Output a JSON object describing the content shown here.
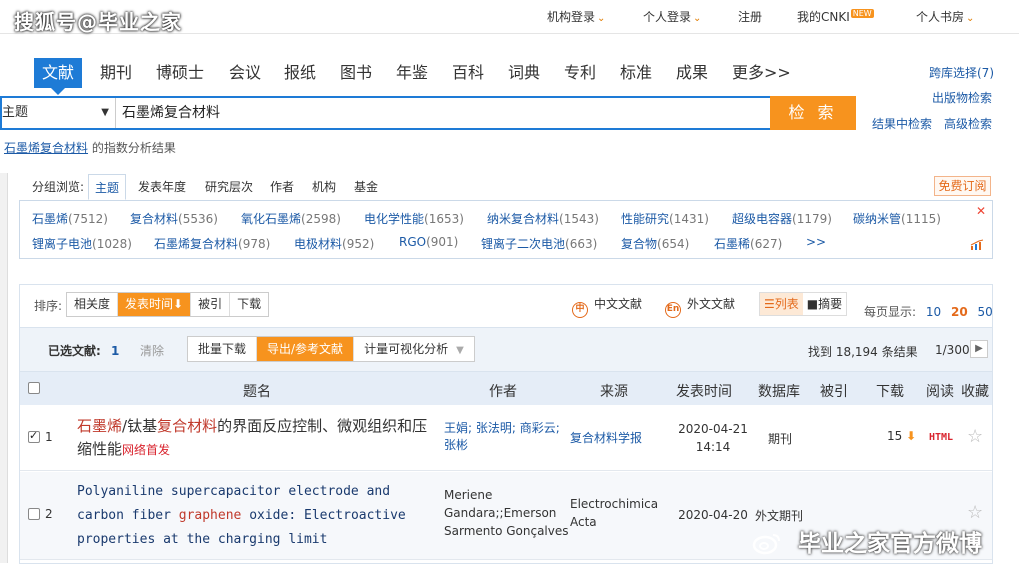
{
  "watermark_top": "搜狐号@毕业之家",
  "watermark_bottom": "毕业之家官方微博",
  "topbar": {
    "org_login": "机构登录",
    "personal_login": "个人登录",
    "register": "注册",
    "my_cnki": "我的CNKI",
    "new_badge": "NEW",
    "bookroom": "个人书房"
  },
  "nav": {
    "tabs": [
      "文献",
      "期刊",
      "博硕士",
      "会议",
      "报纸",
      "图书",
      "年鉴",
      "百科",
      "词典",
      "专利",
      "标准",
      "成果",
      "更多>>"
    ]
  },
  "right_links": {
    "cross_db": "跨库选择(7)",
    "publication_search": "出版物检索",
    "in_result_search": "结果中检索",
    "advanced_search": "高级检索"
  },
  "search": {
    "field": "主题",
    "query": "石墨烯复合材料",
    "button": "检 索"
  },
  "index_analysis": {
    "keyword": "石墨烯复合材料",
    "suffix": "的指数分析结果"
  },
  "group_browse": {
    "label": "分组浏览:",
    "tabs": [
      "主题",
      "发表年度",
      "研究层次",
      "作者",
      "机构",
      "基金"
    ],
    "free_subscribe": "免费订阅"
  },
  "keywords_row1": [
    {
      "name": "石墨烯",
      "count": "(7512)"
    },
    {
      "name": "复合材料",
      "count": "(5536)"
    },
    {
      "name": "氧化石墨烯",
      "count": "(2598)"
    },
    {
      "name": "电化学性能",
      "count": "(1653)"
    },
    {
      "name": "纳米复合材料",
      "count": "(1543)"
    },
    {
      "name": "性能研究",
      "count": "(1431)"
    },
    {
      "name": "超级电容器",
      "count": "(1179)"
    },
    {
      "name": "碳纳米管",
      "count": "(1115)"
    }
  ],
  "keywords_row2": [
    {
      "name": "锂离子电池",
      "count": "(1028)"
    },
    {
      "name": "石墨烯复合材料",
      "count": "(978)"
    },
    {
      "name": "电极材料",
      "count": "(952)"
    },
    {
      "name": "RGO",
      "count": "(901)"
    },
    {
      "name": "锂离子二次电池",
      "count": "(663)"
    },
    {
      "name": "复合物",
      "count": "(654)"
    },
    {
      "name": "石墨稀",
      "count": "(627)"
    }
  ],
  "keywords_more": ">>",
  "sort": {
    "label": "排序:",
    "options": [
      "相关度",
      "发表时间⬇",
      "被引",
      "下载"
    ],
    "chinese_docs": "中文文献",
    "foreign_docs": "外文文献",
    "view_list": "☰列表",
    "view_abstract": "■摘要",
    "per_page_label": "每页显示:",
    "per_page_options": [
      "10",
      "20",
      "50"
    ]
  },
  "selection": {
    "selected_label": "已选文献:",
    "selected_count": "1",
    "clear": "清除",
    "batch_download": "批量下载",
    "export": "导出/参考文献",
    "visual_analysis": "计量可视化分析",
    "found": "找到 18,194 条结果",
    "page": "1/300"
  },
  "table_headers": {
    "title": "题名",
    "author": "作者",
    "source": "来源",
    "date": "发表时间",
    "database": "数据库",
    "cited": "被引",
    "download": "下载",
    "read": "阅读",
    "favorite": "收藏"
  },
  "rows": [
    {
      "num": "1",
      "checked": true,
      "title_hl1": "石墨烯",
      "title_mid": "/钛基",
      "title_hl2": "复合材料",
      "title_rest": "的界面反应控制、微观组织和压缩性能",
      "title_tag": "网络首发",
      "authors_line1": "王娟; 张法明; 商彩云;",
      "authors_line2": "张彬",
      "source": "复合材料学报",
      "date_line1": "2020-04-21",
      "date_line2": "14:14",
      "database": "期刊",
      "downloads": "15",
      "read": "HTML"
    },
    {
      "num": "2",
      "checked": false,
      "title_pre": "Polyaniline supercapacitor electrode and carbon fiber ",
      "title_hl": "graphene",
      "title_post": " oxide: Electroactive properties at the charging limit",
      "authors_line1": "Meriene",
      "authors_line2": "Gandara;;Emerson",
      "authors_line3": "Sarmento Gonçalves",
      "source_line1": "Electrochimica",
      "source_line2": "Acta",
      "date": "2020-04-20",
      "database": "外文期刊"
    }
  ]
}
